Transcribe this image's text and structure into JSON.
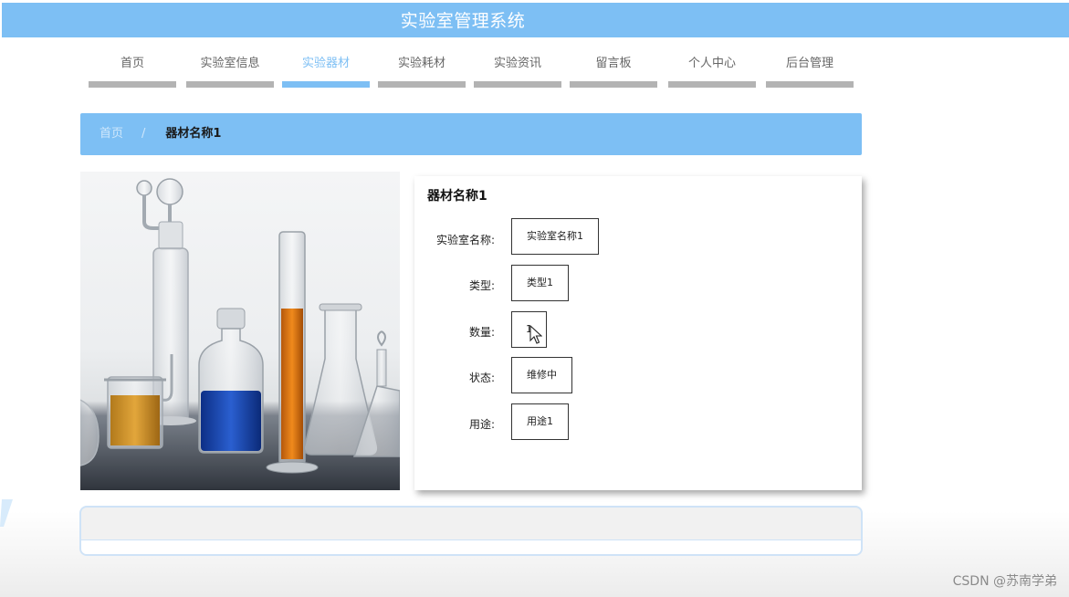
{
  "header": {
    "title": "实验室管理系统"
  },
  "nav": {
    "items": [
      {
        "label": "首页",
        "active": false
      },
      {
        "label": "实验室信息",
        "active": false
      },
      {
        "label": "实验器材",
        "active": true
      },
      {
        "label": "实验耗材",
        "active": false
      },
      {
        "label": "实验资讯",
        "active": false
      },
      {
        "label": "留言板",
        "active": false
      },
      {
        "label": "个人中心",
        "active": false
      },
      {
        "label": "后台管理",
        "active": false
      }
    ]
  },
  "breadcrumb": {
    "home": "首页",
    "separator": "/",
    "current": "器材名称1"
  },
  "detail": {
    "title": "器材名称1",
    "image": "lab-glassware-photo",
    "fields": [
      {
        "label": "实验室名称:",
        "value": "实验室名称1"
      },
      {
        "label": "类型:",
        "value": "类型1"
      },
      {
        "label": "数量:",
        "value": "1"
      },
      {
        "label": "状态:",
        "value": "维修中"
      },
      {
        "label": "用途:",
        "value": "用途1"
      }
    ]
  },
  "watermark": "CSDN @苏南学弟",
  "colors": {
    "primary": "#7dbff4",
    "nav_bar": "#b3b3b3"
  }
}
